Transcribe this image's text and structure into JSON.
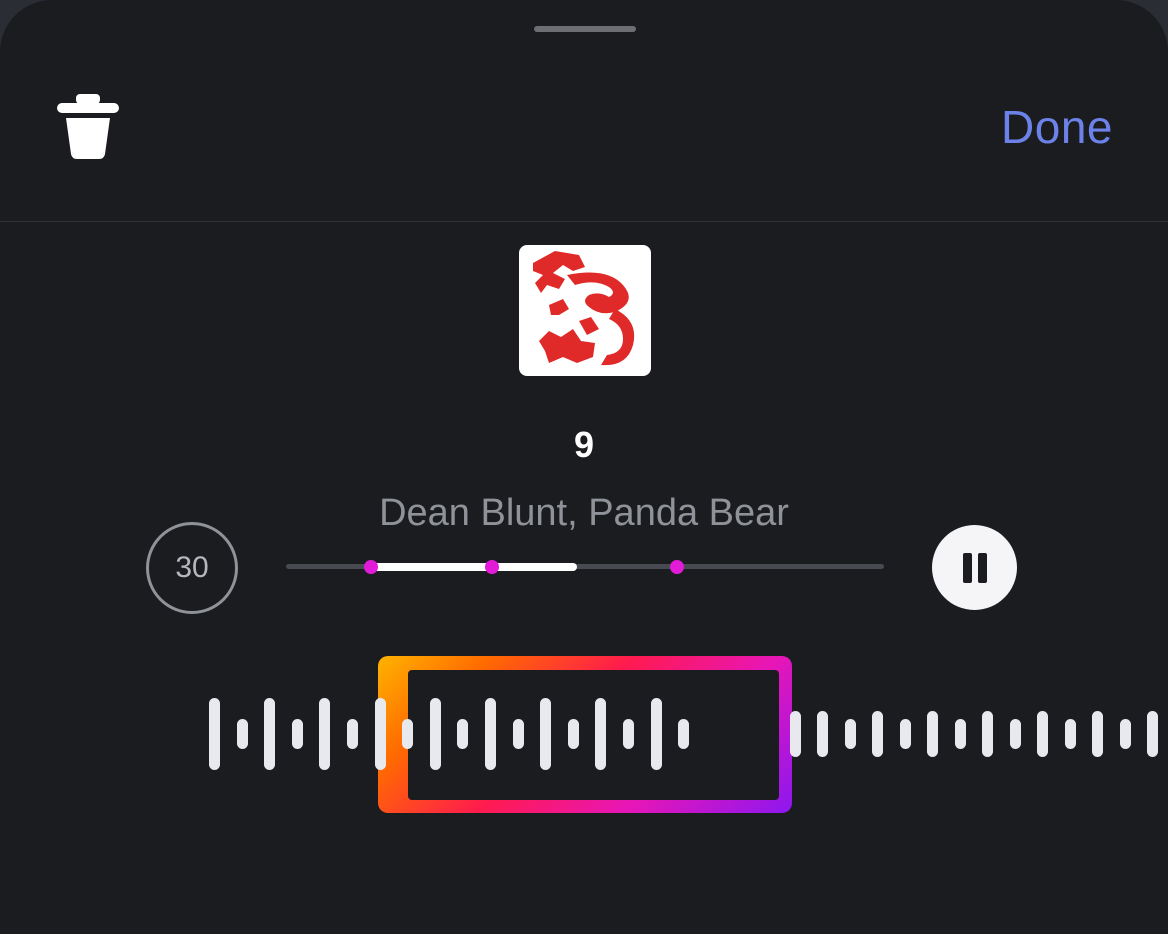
{
  "header": {
    "delete_icon": "trash-icon",
    "done_label": "Done",
    "accent_color": "#6c82e8"
  },
  "track": {
    "title": "9",
    "artist": "Dean Blunt, Panda Bear",
    "artwork_icon": "red-dragon-artwork"
  },
  "controls": {
    "skip_label": "30",
    "pause_icon": "pause-icon",
    "progress": 0.49,
    "selection_start": 0.14
  },
  "colors": {
    "background": "#1b1c20",
    "marker": "#e11bd8",
    "selector_gradient": [
      "#ffb400",
      "#ff1a4f",
      "#e816b6",
      "#8c17f0"
    ]
  }
}
